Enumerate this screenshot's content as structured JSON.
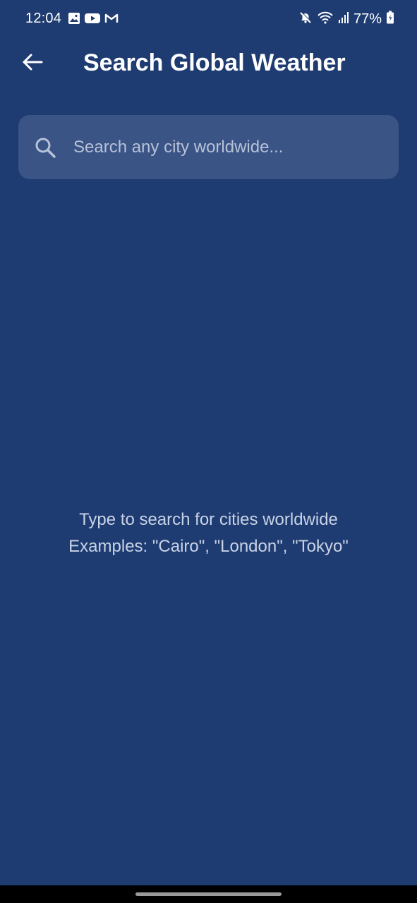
{
  "status_bar": {
    "time": "12:04",
    "battery": "77%",
    "left_icons": [
      "image-icon",
      "youtube-icon",
      "gmail-icon"
    ],
    "right_icons": [
      "mute-icon",
      "wifi-icon",
      "signal-icon",
      "battery-icon"
    ]
  },
  "header": {
    "title": "Search Global Weather",
    "back_icon": "back-arrow-icon"
  },
  "search": {
    "placeholder": "Search any city worldwide...",
    "value": "",
    "icon": "search-icon"
  },
  "empty_state": {
    "line1": "Type to search for cities worldwide",
    "line2": "Examples: \"Cairo\", \"London\", \"Tokyo\""
  },
  "colors": {
    "background": "#1F3C72",
    "search_field": "#3A5486",
    "placeholder": "#B7C2D8",
    "hint_text": "#C9D3E6"
  }
}
